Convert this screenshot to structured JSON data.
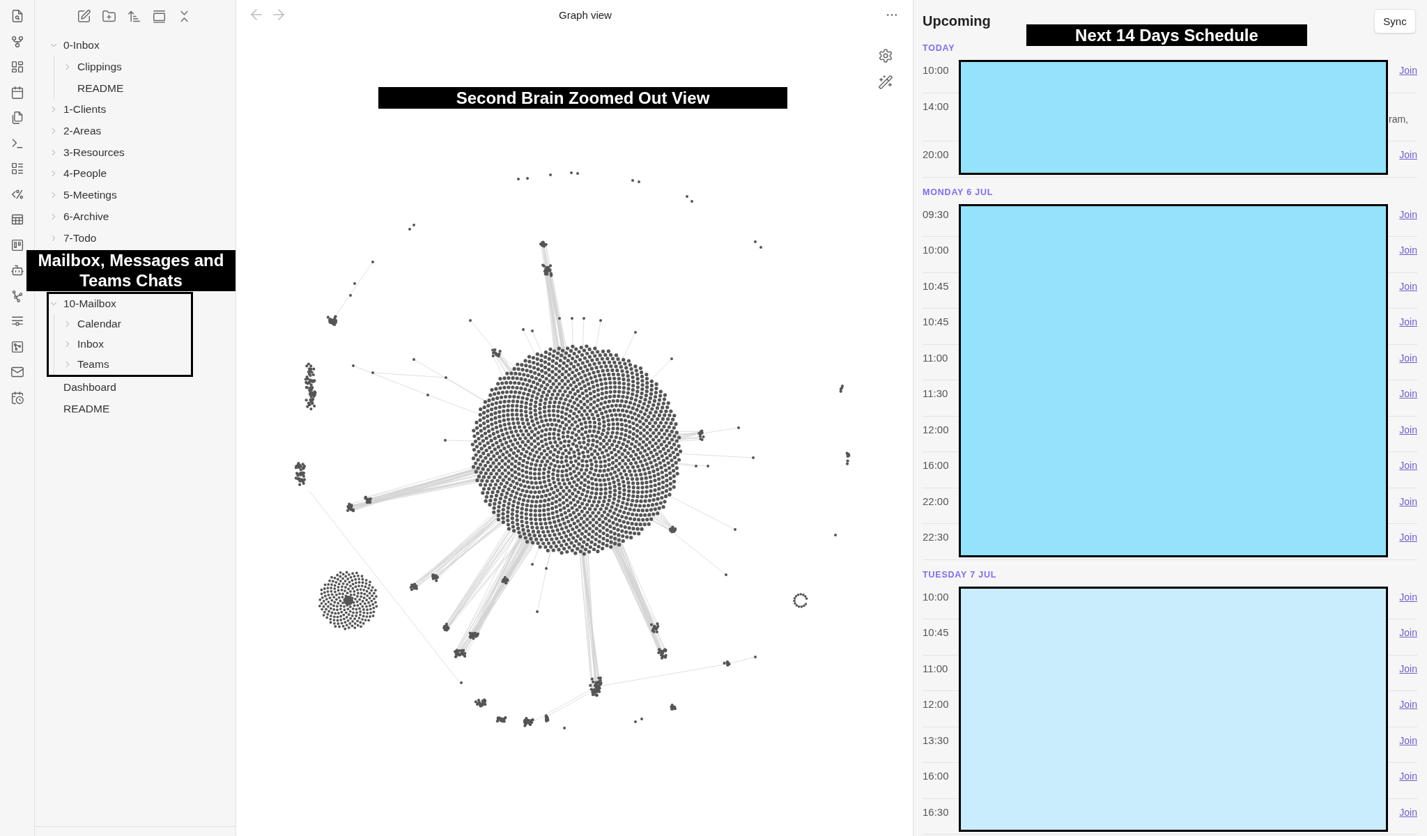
{
  "sidebar": {
    "tree": [
      {
        "label": "0-Inbox",
        "kind": "folder",
        "expanded": true,
        "children": [
          {
            "label": "Clippings",
            "kind": "folder",
            "expanded": false
          },
          {
            "label": "README",
            "kind": "file"
          }
        ]
      },
      {
        "label": "1-Clients",
        "kind": "folder",
        "expanded": false
      },
      {
        "label": "2-Areas",
        "kind": "folder",
        "expanded": false
      },
      {
        "label": "3-Resources",
        "kind": "folder",
        "expanded": false
      },
      {
        "label": "4-People",
        "kind": "folder",
        "expanded": false
      },
      {
        "label": "5-Meetings",
        "kind": "folder",
        "expanded": false
      },
      {
        "label": "6-Archive",
        "kind": "folder",
        "expanded": false
      },
      {
        "label": "7-Todo",
        "kind": "folder",
        "expanded": false
      },
      {
        "label": "10-Mailbox",
        "kind": "folder",
        "expanded": true,
        "callout": "Mailbox, Messages and Teams Chats",
        "children": [
          {
            "label": "Calendar",
            "kind": "folder",
            "expanded": false
          },
          {
            "label": "Inbox",
            "kind": "folder",
            "expanded": false
          },
          {
            "label": "Teams",
            "kind": "folder",
            "expanded": false
          }
        ]
      },
      {
        "label": "Dashboard",
        "kind": "file"
      },
      {
        "label": "README",
        "kind": "file"
      }
    ]
  },
  "graph": {
    "title": "Graph view",
    "callout": "Second Brain Zoomed Out View"
  },
  "upcoming": {
    "title": "Upcoming",
    "sync_button": "Sync",
    "callout": "Next 14 Days Schedule",
    "days": [
      {
        "label": "TODAY",
        "color": "#94e2fc",
        "events": [
          {
            "time": "10:00",
            "join": "Join"
          },
          {
            "time": "14:00",
            "note": "ram,"
          },
          {
            "time": "20:00",
            "join": "Join"
          }
        ]
      },
      {
        "label": "MONDAY 6 JUL",
        "color": "#94e2fc",
        "events": [
          {
            "time": "09:30",
            "join": "Join"
          },
          {
            "time": "10:00",
            "join": "Join"
          },
          {
            "time": "10:45",
            "join": "Join"
          },
          {
            "time": "10:45",
            "join": "Join"
          },
          {
            "time": "11:00",
            "join": "Join"
          },
          {
            "time": "11:30",
            "join": "Join"
          },
          {
            "time": "12:00",
            "join": "Join"
          },
          {
            "time": "16:00",
            "join": "Join"
          },
          {
            "time": "22:00",
            "join": "Join"
          },
          {
            "time": "22:30",
            "join": "Join"
          }
        ]
      },
      {
        "label": "TUESDAY 7 JUL",
        "color": "#c9edfc",
        "events": [
          {
            "time": "10:00",
            "join": "Join"
          },
          {
            "time": "10:45",
            "join": "Join"
          },
          {
            "time": "11:00",
            "join": "Join"
          },
          {
            "time": "12:00",
            "join": "Join"
          },
          {
            "time": "13:30",
            "join": "Join"
          },
          {
            "time": "16:00",
            "join": "Join"
          },
          {
            "time": "16:30",
            "join": "Join"
          }
        ]
      }
    ]
  }
}
